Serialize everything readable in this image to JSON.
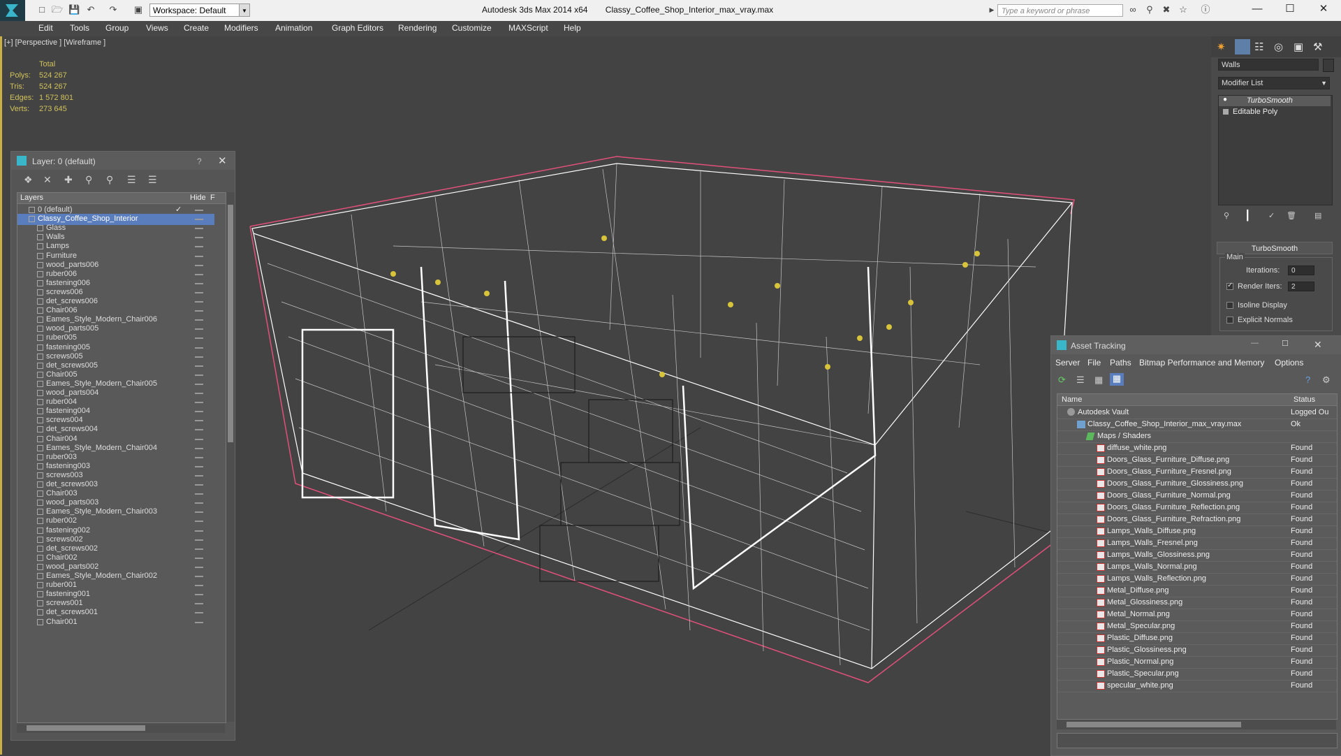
{
  "app": {
    "title": "Autodesk 3ds Max  2014 x64",
    "file": "Classy_Coffee_Shop_Interior_max_vray.max",
    "workspace": "Workspace: Default",
    "search_placeholder": "Type a keyword or phrase"
  },
  "menu": [
    "Edit",
    "Tools",
    "Group",
    "Views",
    "Create",
    "Modifiers",
    "Animation",
    "Graph Editors",
    "Rendering",
    "Customize",
    "MAXScript",
    "Help"
  ],
  "viewport": {
    "label": "[+] [Perspective ] [Wireframe ]",
    "stats": {
      "header": "Total",
      "rows": [
        {
          "k": "Polys:",
          "v": "524 267"
        },
        {
          "k": "Tris:",
          "v": "524 267"
        },
        {
          "k": "Edges:",
          "v": "1 572 801"
        },
        {
          "k": "Verts:",
          "v": "273 645"
        }
      ]
    }
  },
  "layer_panel": {
    "title": "Layer: 0 (default)",
    "help": "?",
    "col_layers": "Layers",
    "col_hide": "Hide",
    "col_f": "F",
    "items": [
      "0 (default)",
      "Classy_Coffee_Shop_Interior",
      "Glass",
      "Walls",
      "Lamps",
      "Furniture",
      "wood_parts006",
      "ruber006",
      "fastening006",
      "screws006",
      "det_screws006",
      "Chair006",
      "Eames_Style_Modern_Chair006",
      "wood_parts005",
      "ruber005",
      "fastening005",
      "screws005",
      "det_screws005",
      "Chair005",
      "Eames_Style_Modern_Chair005",
      "wood_parts004",
      "ruber004",
      "fastening004",
      "screws004",
      "det_screws004",
      "Chair004",
      "Eames_Style_Modern_Chair004",
      "ruber003",
      "fastening003",
      "screws003",
      "det_screws003",
      "Chair003",
      "wood_parts003",
      "Eames_Style_Modern_Chair003",
      "ruber002",
      "fastening002",
      "screws002",
      "det_screws002",
      "Chair002",
      "wood_parts002",
      "Eames_Style_Modern_Chair002",
      "ruber001",
      "fastening001",
      "screws001",
      "det_screws001",
      "Chair001"
    ]
  },
  "command_panel": {
    "object_name": "Walls",
    "modifier_list": "Modifier List",
    "stack": [
      "TurboSmooth",
      "Editable Poly"
    ],
    "rollout_title": "TurboSmooth",
    "group_main": "Main",
    "iterations_label": "Iterations:",
    "iterations_value": "0",
    "render_iters_label": "Render Iters:",
    "render_iters_value": "2",
    "isoline_label": "Isoline Display",
    "explicit_label": "Explicit Normals"
  },
  "asset_tracking": {
    "title": "Asset Tracking",
    "menu": [
      "Server",
      "File",
      "Paths",
      "Bitmap Performance and Memory",
      "Options"
    ],
    "col_name": "Name",
    "col_status": "Status",
    "rows": [
      {
        "name": "Autodesk Vault",
        "status": "Logged Ou",
        "level": 0,
        "kind": "vault"
      },
      {
        "name": "Classy_Coffee_Shop_Interior_max_vray.max",
        "status": "Ok",
        "level": 1,
        "kind": "max"
      },
      {
        "name": "Maps / Shaders",
        "status": "",
        "level": 2,
        "kind": "maps"
      },
      {
        "name": "diffuse_white.png",
        "status": "Found",
        "level": 3,
        "kind": "png"
      },
      {
        "name": "Doors_Glass_Furniture_Diffuse.png",
        "status": "Found",
        "level": 3,
        "kind": "png"
      },
      {
        "name": "Doors_Glass_Furniture_Fresnel.png",
        "status": "Found",
        "level": 3,
        "kind": "png"
      },
      {
        "name": "Doors_Glass_Furniture_Glossiness.png",
        "status": "Found",
        "level": 3,
        "kind": "png"
      },
      {
        "name": "Doors_Glass_Furniture_Normal.png",
        "status": "Found",
        "level": 3,
        "kind": "png"
      },
      {
        "name": "Doors_Glass_Furniture_Reflection.png",
        "status": "Found",
        "level": 3,
        "kind": "png"
      },
      {
        "name": "Doors_Glass_Furniture_Refraction.png",
        "status": "Found",
        "level": 3,
        "kind": "png"
      },
      {
        "name": "Lamps_Walls_Diffuse.png",
        "status": "Found",
        "level": 3,
        "kind": "png"
      },
      {
        "name": "Lamps_Walls_Fresnel.png",
        "status": "Found",
        "level": 3,
        "kind": "png"
      },
      {
        "name": "Lamps_Walls_Glossiness.png",
        "status": "Found",
        "level": 3,
        "kind": "png"
      },
      {
        "name": "Lamps_Walls_Normal.png",
        "status": "Found",
        "level": 3,
        "kind": "png"
      },
      {
        "name": "Lamps_Walls_Reflection.png",
        "status": "Found",
        "level": 3,
        "kind": "png"
      },
      {
        "name": "Metal_Diffuse.png",
        "status": "Found",
        "level": 3,
        "kind": "png"
      },
      {
        "name": "Metal_Glossiness.png",
        "status": "Found",
        "level": 3,
        "kind": "png"
      },
      {
        "name": "Metal_Normal.png",
        "status": "Found",
        "level": 3,
        "kind": "png"
      },
      {
        "name": "Metal_Specular.png",
        "status": "Found",
        "level": 3,
        "kind": "png"
      },
      {
        "name": "Plastic_Diffuse.png",
        "status": "Found",
        "level": 3,
        "kind": "png"
      },
      {
        "name": "Plastic_Glossiness.png",
        "status": "Found",
        "level": 3,
        "kind": "png"
      },
      {
        "name": "Plastic_Normal.png",
        "status": "Found",
        "level": 3,
        "kind": "png"
      },
      {
        "name": "Plastic_Specular.png",
        "status": "Found",
        "level": 3,
        "kind": "png"
      },
      {
        "name": "specular_white.png",
        "status": "Found",
        "level": 3,
        "kind": "png"
      }
    ]
  },
  "colors": {
    "accent_selection": "#5a7dbd",
    "stats_yellow": "#d2c25a",
    "viewport_border": "#c9b046",
    "wire": "#ffffff",
    "bbox": "#e0507a"
  }
}
